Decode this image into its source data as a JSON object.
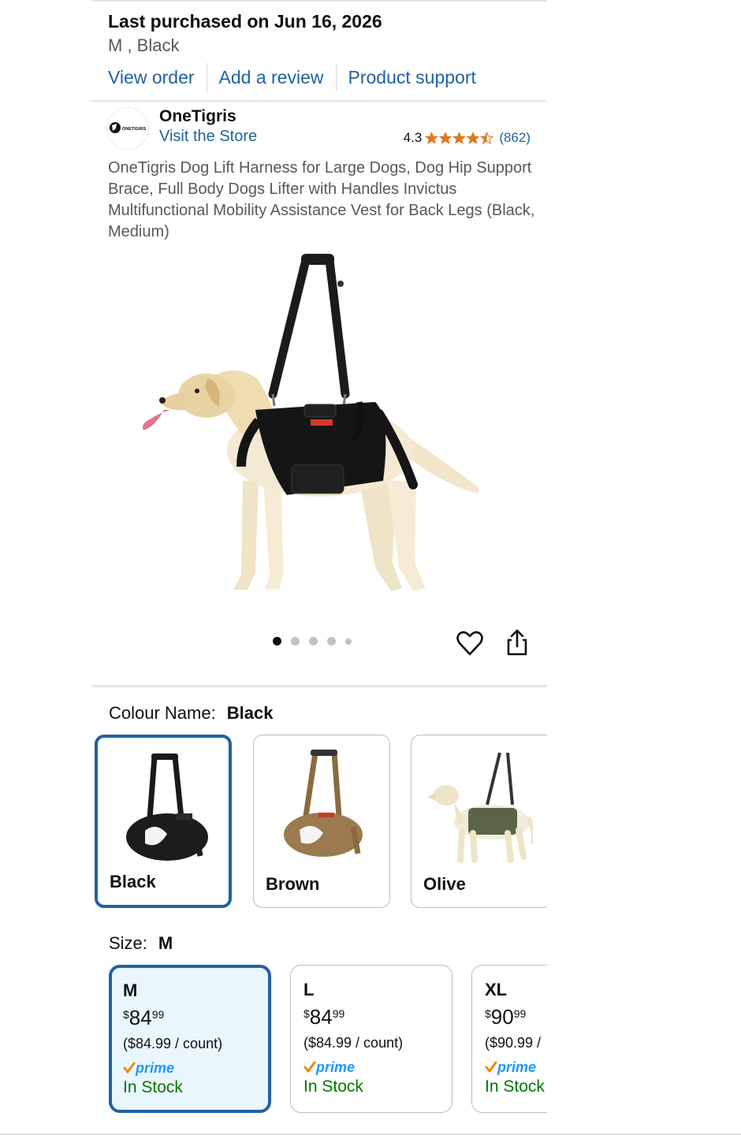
{
  "last_purchase": {
    "title": "Last purchased on Jun 16, 2026",
    "variant": "M , Black",
    "links": [
      "View order",
      "Add a review",
      "Product support"
    ]
  },
  "brand": {
    "name": "OneTigris",
    "logo_text": "ONETIGRIS",
    "visit_store": "Visit the Store",
    "rating": "4.3",
    "rating_value": 4.3,
    "rating_count": "(862)"
  },
  "product": {
    "title": "OneTigris Dog Lift Harness for Large Dogs, Dog Hip Support Brace, Full Body Dogs Lifter with Handles Invictus Multifunctional Mobility Assistance Vest for Back Legs (Black, Medium)",
    "image_icon": "dog-harness-photo",
    "image_count": 5,
    "active_image": 1
  },
  "colour": {
    "label": "Colour Name:",
    "selected": "Black",
    "options": [
      {
        "label": "Black",
        "color": "#1c1c1c"
      },
      {
        "label": "Brown",
        "color": "#9a7a4e"
      },
      {
        "label": "Olive",
        "color": "#5b6446"
      }
    ]
  },
  "size": {
    "label": "Size:",
    "selected": "M",
    "options": [
      {
        "name": "M",
        "currency": "$",
        "whole": "84",
        "fraction": "99",
        "unit_price": "($84.99 / count)",
        "prime": "prime",
        "stock": "In Stock"
      },
      {
        "name": "L",
        "currency": "$",
        "whole": "84",
        "fraction": "99",
        "unit_price": "($84.99 / count)",
        "prime": "prime",
        "stock": "In Stock"
      },
      {
        "name": "XL",
        "currency": "$",
        "whole": "90",
        "fraction": "99",
        "unit_price": "($90.99 /",
        "prime": "prime",
        "stock": "In Stock"
      }
    ]
  },
  "colors": {
    "link": "#2162a1",
    "selected_border": "#2162a1",
    "star": "#de7921",
    "prime_blue": "#1a98ff",
    "prime_check": "#f08804",
    "in_stock": "#007600"
  }
}
